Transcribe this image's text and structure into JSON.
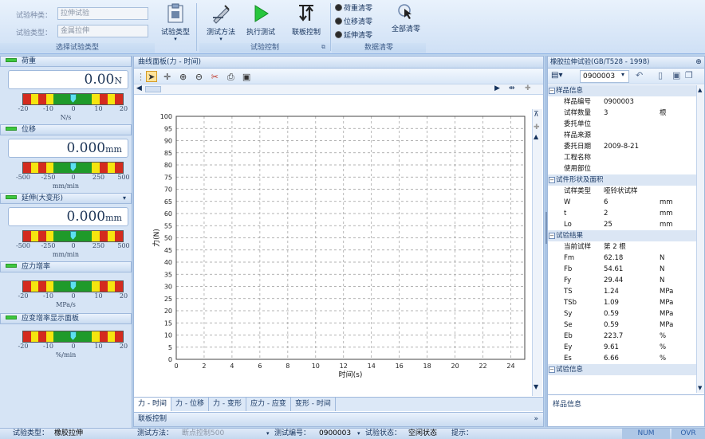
{
  "ribbon": {
    "test_kind_label": "试验种类：",
    "test_kind_value": "拉伸试验",
    "test_type_label": "试验类型：",
    "test_type_value": "金属拉伸",
    "select_type_btn": "试验类型",
    "group_select": "选择试验类型",
    "test_method_btn": "测试方法",
    "run_test_btn": "执行测试",
    "joint_ctrl_btn": "联板控制",
    "group_ctrl": "试验控制",
    "zero_load": "荷重清零",
    "zero_disp": "位移清零",
    "zero_ext": "延伸清零",
    "zero_all": "全部清零",
    "group_zero": "数据清零"
  },
  "left": {
    "load": {
      "title": "荷重",
      "value": "0.00",
      "unit": "N",
      "ticks": [
        "-20",
        "-10",
        "0",
        "10",
        "20"
      ],
      "rate_unit": "N/s"
    },
    "disp": {
      "title": "位移",
      "value": "0.000",
      "unit": "mm",
      "ticks": [
        "-500",
        "-250",
        "0",
        "250",
        "500"
      ],
      "rate_unit": "mm/min"
    },
    "ext": {
      "title": "延伸(大变形)",
      "value": "0.000",
      "unit": "mm",
      "ticks": [
        "-500",
        "-250",
        "0",
        "250",
        "500"
      ],
      "rate_unit": "mm/min"
    },
    "stress": {
      "title": "应力增率",
      "ticks": [
        "-20",
        "-10",
        "0",
        "10",
        "20"
      ],
      "rate_unit": "MPa/s"
    },
    "strain": {
      "title": "应变增率显示面板",
      "ticks": [
        "-20",
        "-10",
        "0",
        "10",
        "20"
      ],
      "rate_unit": "%/min"
    }
  },
  "center": {
    "title": "曲线面板(力 - 时间)",
    "tabs": [
      "力 - 时间",
      "力 - 位移",
      "力 - 变形",
      "应力 - 应变",
      "变形 - 时间"
    ],
    "joint": "联板控制"
  },
  "chart_data": {
    "type": "line",
    "xlabel": "时间(s)",
    "ylabel": "力(N)",
    "xlim": [
      0,
      25
    ],
    "ylim": [
      0,
      100
    ],
    "xticks": [
      "0",
      "2",
      "4",
      "6",
      "8",
      "10",
      "12",
      "14",
      "16",
      "18",
      "20",
      "22",
      "24"
    ],
    "yticks": [
      "0",
      "5",
      "10",
      "15",
      "20",
      "25",
      "30",
      "35",
      "40",
      "45",
      "50",
      "55",
      "60",
      "65",
      "70",
      "75",
      "80",
      "85",
      "90",
      "95",
      "100"
    ],
    "grid": true,
    "series": []
  },
  "right": {
    "title": "橡胶拉伸试验(GB/T528 - 1998)",
    "sample_no": "0900003",
    "sections": [
      {
        "name": "样品信息",
        "rows": [
          [
            "样品编号",
            "0900003",
            ""
          ],
          [
            "试样数量",
            "3",
            "根"
          ],
          [
            "委托单位",
            "",
            ""
          ],
          [
            "样品来源",
            "",
            ""
          ],
          [
            "委托日期",
            "2009-8-21",
            ""
          ],
          [
            "工程名称",
            "",
            ""
          ],
          [
            "使用部位",
            "",
            ""
          ]
        ]
      },
      {
        "name": "试件形状及面积",
        "rows": [
          [
            "试样类型",
            "哑铃状试样",
            ""
          ],
          [
            "W",
            "6",
            "mm"
          ],
          [
            "t",
            "2",
            "mm"
          ],
          [
            "Lo",
            "25",
            "mm"
          ]
        ]
      },
      {
        "name": "试验结果",
        "rows": [
          [
            "当前试样",
            "第 2 根",
            ""
          ],
          [
            "Fm",
            "62.18",
            "N"
          ],
          [
            "Fb",
            "54.61",
            "N"
          ],
          [
            "Fy",
            "29.44",
            "N"
          ],
          [
            "TS",
            "1.24",
            "MPa"
          ],
          [
            "TSb",
            "1.09",
            "MPa"
          ],
          [
            "Sy",
            "0.59",
            "MPa"
          ],
          [
            "Se",
            "0.59",
            "MPa"
          ],
          [
            "Eb",
            "223.7",
            "%"
          ],
          [
            "Ey",
            "9.61",
            "%"
          ],
          [
            "Es",
            "6.66",
            "%"
          ]
        ]
      },
      {
        "name": "试验信息",
        "rows": []
      }
    ],
    "footer": "样品信息"
  },
  "status": {
    "type_label": "试验类型：",
    "type_value": "橡胶拉伸",
    "method_label": "测试方法：",
    "method_value": "断点控制500",
    "no_label": "测试编号：",
    "no_value": "0900003",
    "state_label": "试验状态：",
    "state_value": "空闲状态",
    "hint_label": "提示：",
    "num": "NUM",
    "ovr": "OVR"
  },
  "colors": {
    "gauge_red": "#d42b1e",
    "gauge_yellow": "#f5e50f",
    "gauge_green": "#1f9a2a",
    "needle": "#5de0f0"
  }
}
